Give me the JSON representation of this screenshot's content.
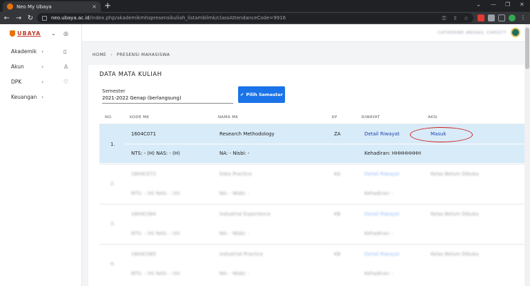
{
  "browser": {
    "tab_title": "Neo My Ubaya",
    "tab_close": "×",
    "new_tab": "+",
    "url_host": "neo.ubaya.ac.id",
    "url_path": "/index.php/akademikmhspresensikuliah_listambilmk/classAttendanceCode=9916",
    "controls": [
      "⌄",
      "—",
      "❐",
      "✕"
    ]
  },
  "sidebar": {
    "logo": "UBAYA",
    "items": [
      {
        "label": "Akademik",
        "icon": "book-icon"
      },
      {
        "label": "Akun",
        "icon": "user-icon"
      },
      {
        "label": "DPK",
        "icon": "badge-icon"
      },
      {
        "label": "Keuangan",
        "icon": ""
      }
    ]
  },
  "topbar": {
    "username": "CATHERINE ABIGAIL CHRISTY"
  },
  "breadcrumb": {
    "home": "HOME",
    "sep": "›",
    "current": "PRESENSI MAHASISWA"
  },
  "main": {
    "title": "DATA MATA KULIAH",
    "semester_label": "Semester",
    "semester_value": "2021-2022 Genap (berlangsung)",
    "semester_button": "Pilih Semester",
    "columns": [
      "NO.",
      "KODE MK",
      "NAMA MK",
      "KP",
      "RIWAYAT",
      "AKSI"
    ],
    "rows": [
      {
        "no": "1.",
        "kode": "1604C071",
        "nama": "Research Methodology",
        "kp": "ZA",
        "riwayat": "Detail Riwayat",
        "aksi": "Masuk",
        "nilai1": "NTS: - (H) NAS: - (H)",
        "nilai2": "NA: - Nisbi: -",
        "kehadiran": "Kehadiran: HHHHHHHH"
      },
      {
        "no": "2.",
        "kode": "1604C072",
        "nama": "Data Practice",
        "kp": "KA",
        "riwayat": "Detail Riwayat",
        "aksi": "Kelas Belum Dibuka",
        "nilai1": "NTS: - (H) NAS: - (H)",
        "nilai2": "NA: - Nisbi: -",
        "kehadiran": "Kehadiran: -"
      },
      {
        "no": "3.",
        "kode": "1604C084",
        "nama": "Industrial Experience",
        "kp": "KB",
        "riwayat": "Detail Riwayat",
        "aksi": "Kelas Belum Dibuka",
        "nilai1": "NTS: - (H) NAS: - (H)",
        "nilai2": "NA: - Nisbi: -",
        "kehadiran": "Kehadiran: -"
      },
      {
        "no": "4.",
        "kode": "1604C085",
        "nama": "Industrial Practice",
        "kp": "KB",
        "riwayat": "Detail Riwayat",
        "aksi": "Kelas Belum Dibuka",
        "nilai1": "NTS: - (H) NAS: - (H)",
        "nilai2": "NA: - Nisbi: -",
        "kehadiran": "Kehadiran: -"
      }
    ]
  },
  "colors": {
    "accent": "#1a73e8",
    "highlight_row": "#d8ebf8",
    "annotation": "#d11b1b"
  }
}
